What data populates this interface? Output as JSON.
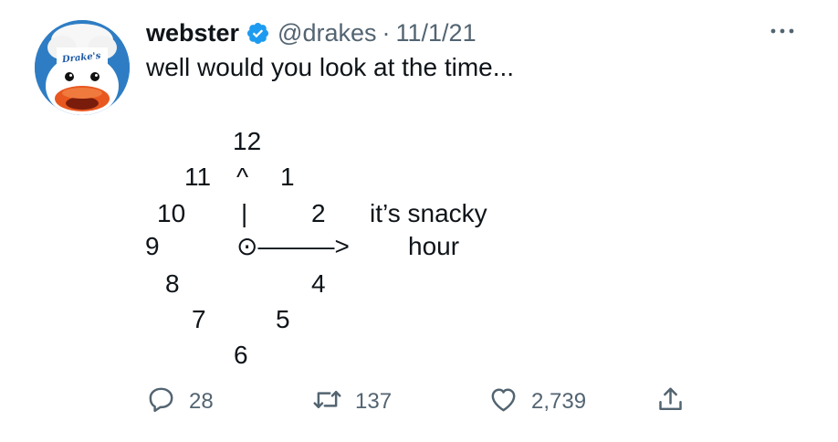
{
  "tweet": {
    "display_name": "webster",
    "handle": "@drakes",
    "separator": "·",
    "date": "11/1/21",
    "text": "well would you look at the time...",
    "avatar_logo_text": "Drake's",
    "clock": {
      "n12": "12",
      "n11": "11",
      "caret": "^",
      "n1": "1",
      "n10": "10",
      "bar": "|",
      "n2": "2",
      "snacky": "it’s snacky",
      "n9": "9",
      "hand": "⊙———>",
      "hour": "hour",
      "n8": "8",
      "n4": "4",
      "n7": "7",
      "n5": "5",
      "n6": "6"
    },
    "stats": {
      "replies": "28",
      "retweets": "137",
      "likes": "2,739"
    }
  },
  "icons": {
    "avatar": "duck-chef-avatar",
    "verified": "verified-badge-icon",
    "more": "more-dots-icon",
    "reply": "reply-icon",
    "retweet": "retweet-icon",
    "like": "heart-icon",
    "share": "share-icon"
  },
  "colors": {
    "text": "#0f1419",
    "secondary": "#536471",
    "verified": "#1d9bf0",
    "avatar_bg": "#2e7dc4",
    "beak": "#e8571f"
  }
}
